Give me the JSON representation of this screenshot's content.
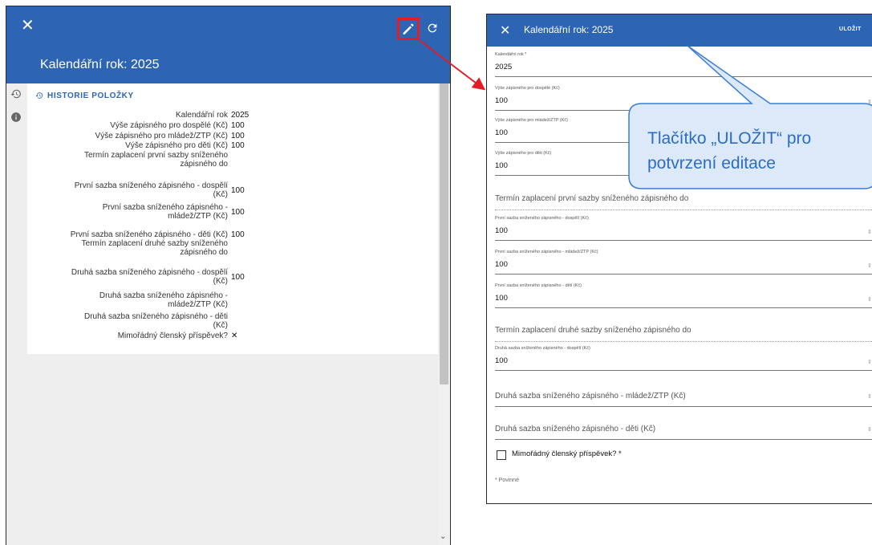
{
  "left": {
    "close_icon": "close-icon",
    "title": "Kalendářní rok: 2025",
    "history_heading": "HISTORIE POLOŽKY",
    "scroll_down_glyph": "⌄",
    "rows": [
      {
        "label": "Kalendářní rok",
        "value": "2025"
      },
      {
        "label": "Výše zápisného pro dospělé (Kč)",
        "value": "100"
      },
      {
        "label": "Výše zápisného pro mládež/ZTP (Kč)",
        "value": "100"
      },
      {
        "label": "Výše zápisného pro děti (Kč)",
        "value": "100"
      },
      {
        "label_lines": [
          "Termín zaplacení první sazby sníženého",
          "zápisného do"
        ],
        "value": ""
      },
      {
        "label_lines": [
          "První sazba sníženého zápisného - dospělí",
          "(Kč)"
        ],
        "value": "100"
      },
      {
        "label_lines": [
          "První sazba sníženého zápisného -",
          "mládež/ZTP (Kč)"
        ],
        "value": "100"
      },
      {
        "label": "První sazba sníženého zápisného - děti (Kč)",
        "value": "100"
      },
      {
        "label_lines": [
          "Termín zaplacení druhé sazby sníženého",
          "zápisného do"
        ],
        "value": ""
      },
      {
        "label_lines": [
          "Druhá sazba sníženého zápisného - dospělí",
          "(Kč)"
        ],
        "value": "100"
      },
      {
        "label_lines": [
          "Druhá sazba sníženého zápisného -",
          "mládež/ZTP (Kč)"
        ],
        "value": ""
      },
      {
        "label_lines": [
          "Druhá sazba sníženého zápisného - děti",
          "(Kč)"
        ],
        "value": ""
      },
      {
        "label": "Mimořádný členský příspěvek?",
        "value": "✕"
      }
    ]
  },
  "right": {
    "title": "Kalendářní rok: 2025",
    "save_label": "ULOŽIT",
    "fields": [
      {
        "label": "Kalendářní rok *",
        "value": "2025"
      },
      {
        "label": "Výše zápisného pro dospělé (Kč)",
        "value": "100"
      },
      {
        "label": "Výše zápisného pro mládež/ZTP (Kč)",
        "value": "100"
      },
      {
        "label": "Výše zápisného pro děti (Kč)",
        "value": "100"
      },
      {
        "label": "První sazba sníženého zápisného - dospělí (Kč)",
        "value": "100"
      },
      {
        "label": "První sazba sníženého zápisného - mládež/ZTP (Kč)",
        "value": "100"
      },
      {
        "label": "První sazba sníženého zápisného - děti (Kč)",
        "value": "100"
      },
      {
        "label": "Druhá sazba sníženého zápisného - dospělí (Kč)",
        "value": "100"
      }
    ],
    "date1_placeholder": "Termín zaplacení první sazby sníženého zápisného do",
    "date2_placeholder": "Termín zaplacení druhé sazby sníženého zápisného do",
    "empty_field1": "Druhá sazba sníženého zápisného - mládež/ZTP (Kč)",
    "empty_field2": "Druhá sazba sníženého zápisného - děti (Kč)",
    "checkbox_label": "Mimořádný členský příspěvek? *",
    "required_note": "* Povinné"
  },
  "callout": {
    "text": "Tlačítko „ULOŽIT“ pro potvrzení editace"
  },
  "colors": {
    "header_blue": "#2d64b3",
    "highlight_red": "#e21d23",
    "callout_fill": "#dbe9f8",
    "callout_text": "#2e6cc4"
  }
}
